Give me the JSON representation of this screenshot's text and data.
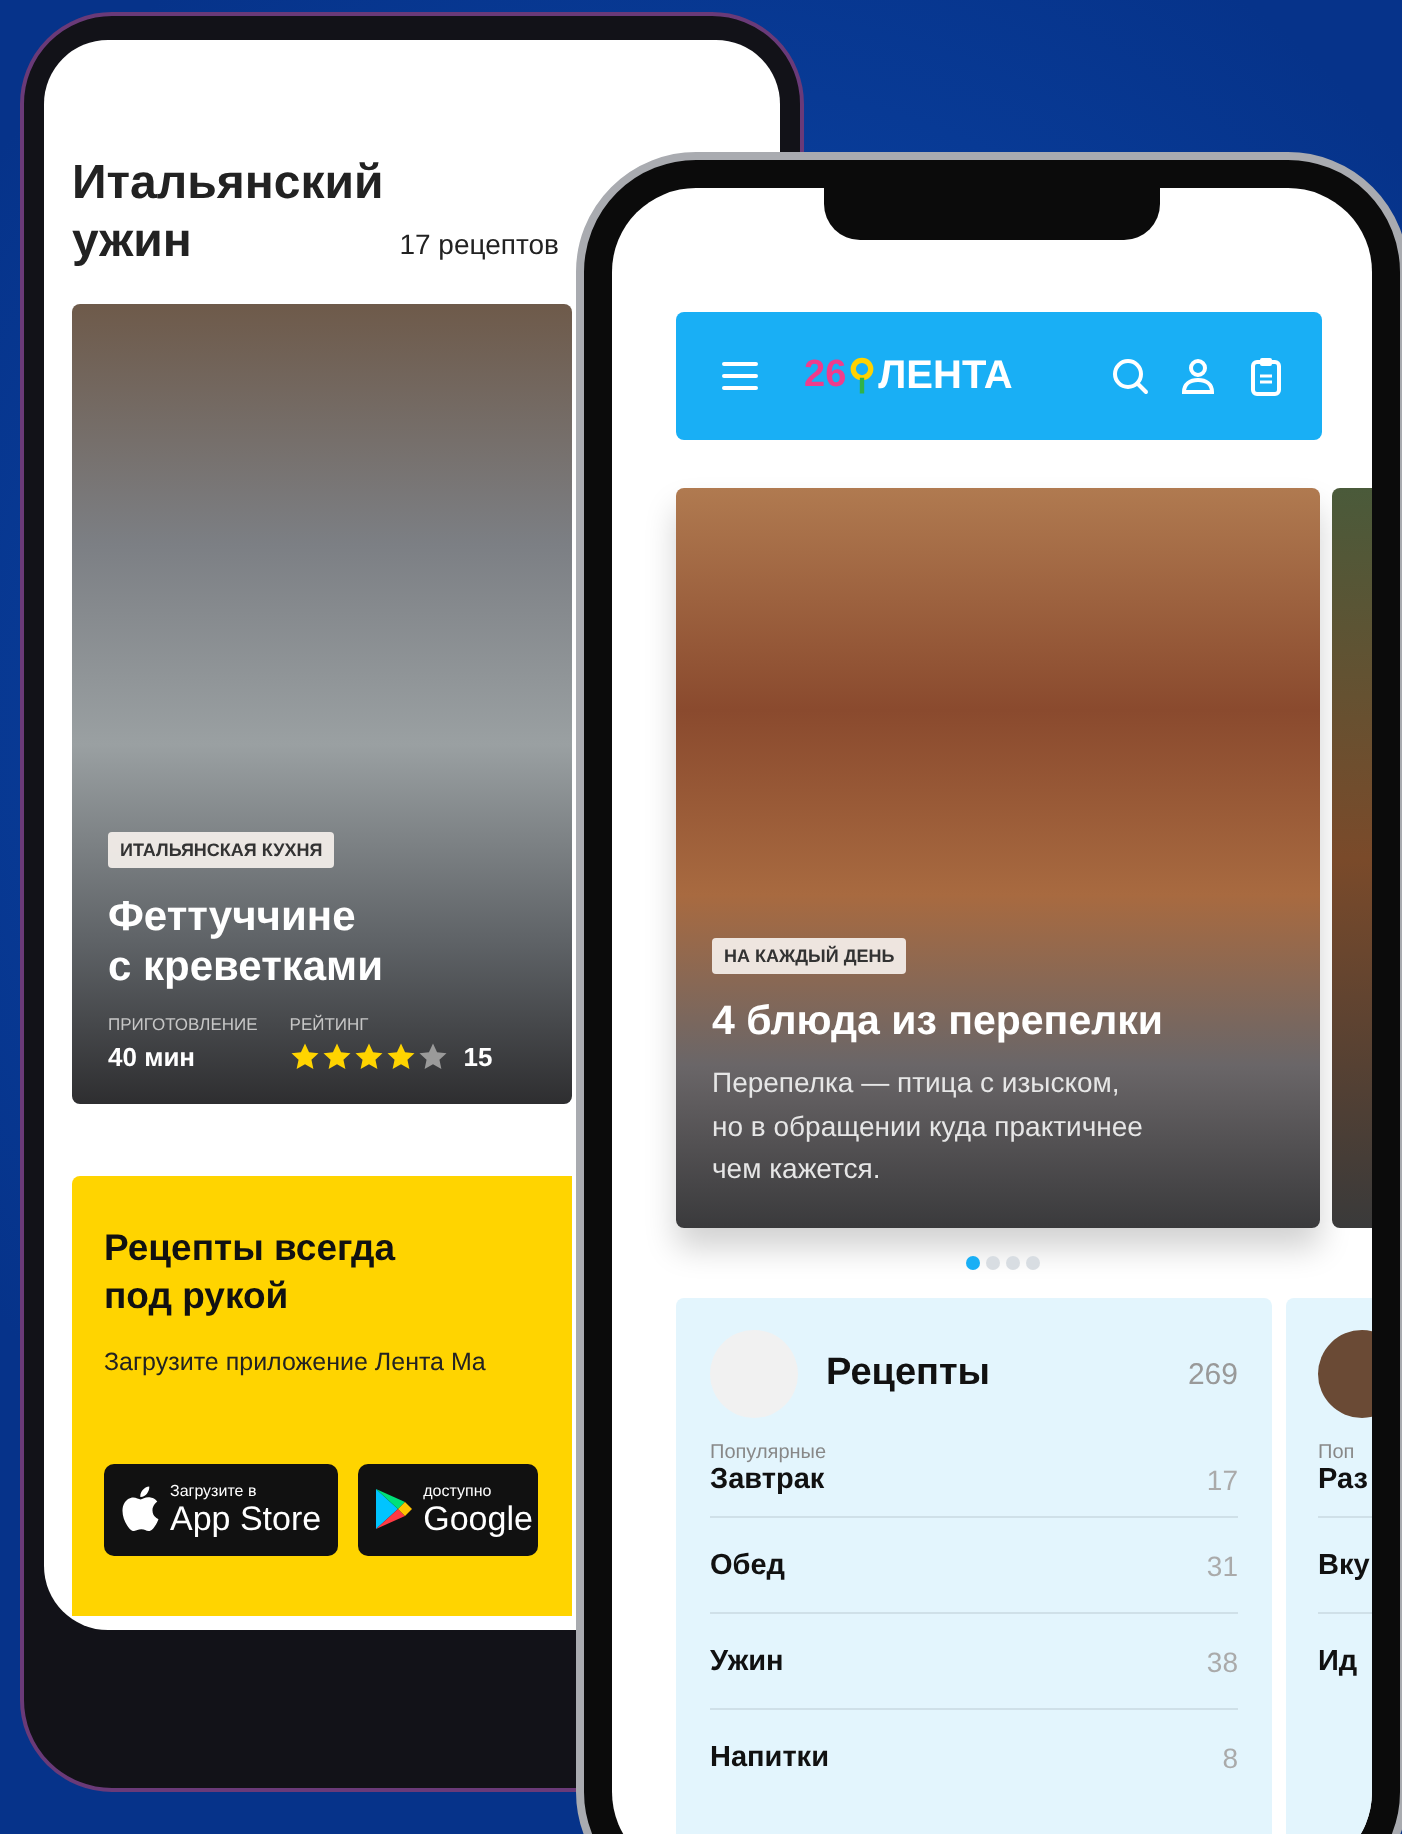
{
  "back_phone": {
    "title": "Итальянский ужин",
    "count": "17 рецептов",
    "recipe_card": {
      "tag": "ИТАЛЬЯНСКАЯ КУХНЯ",
      "title": "Феттуччине\nс креветками",
      "time_label": "ПРИГОТОВЛЕНИЕ",
      "time": "40 мин",
      "rating_label": "РЕЙТИНГ",
      "stars": 4,
      "reviews": "15"
    },
    "promo": {
      "title": "Рецепты всегда\nпод рукой",
      "text": "Загрузите приложение Лента Ma",
      "store_buttons": [
        {
          "kind": "apple",
          "caption": "Загрузите в",
          "label": "App Store"
        },
        {
          "kind": "google",
          "caption": "доступно",
          "label": "Google"
        }
      ]
    }
  },
  "front_phone": {
    "header": {
      "logo_digits": "26",
      "logo": "ЛЕНТА"
    },
    "slide": {
      "tag": "НА КАЖДЫЙ ДЕНЬ",
      "title": "4 блюда из перепелки",
      "text": "Перепелка — птица с изыском,\nно в обращении куда практичнее\nчем кажется."
    },
    "pager": [
      {
        "selected": true
      },
      {
        "selected": false
      },
      {
        "selected": false
      },
      {
        "selected": false
      }
    ],
    "categories": [
      {
        "title": "Рецепты",
        "count": "269",
        "section": "Популярные",
        "items": [
          {
            "name": "Завтрак",
            "count": "17"
          },
          {
            "name": "Обед",
            "count": "31"
          },
          {
            "name": "Ужин",
            "count": "38"
          },
          {
            "name": "Напитки",
            "count": "8"
          }
        ]
      },
      {
        "section": "Поп",
        "items": [
          {
            "name": "Раз"
          },
          {
            "name": "Вку"
          },
          {
            "name": "Ид"
          }
        ]
      }
    ]
  }
}
